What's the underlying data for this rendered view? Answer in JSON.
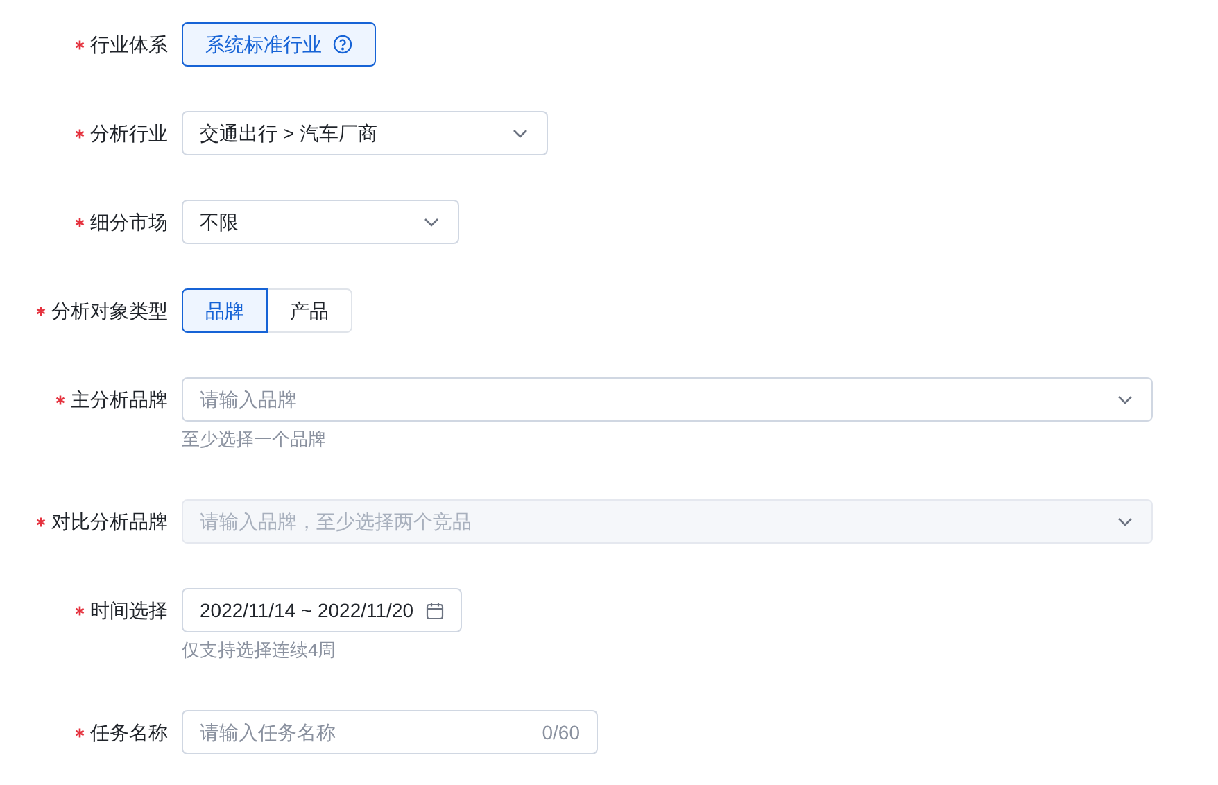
{
  "form": [
    {
      "label": "行业体系",
      "required": true,
      "kind": "tag",
      "value": "系统标准行业"
    },
    {
      "label": "分析行业",
      "required": true,
      "kind": "select",
      "value": "交通出行 > 汽车厂商"
    },
    {
      "label": "细分市场",
      "required": true,
      "kind": "select",
      "value": "不限"
    },
    {
      "label": "分析对象类型",
      "required": true,
      "kind": "segmented",
      "options": [
        {
          "label": "品牌",
          "selected": true
        },
        {
          "label": "产品",
          "selected": false
        }
      ]
    },
    {
      "label": "主分析品牌",
      "required": true,
      "kind": "select",
      "placeholder": "请输入品牌",
      "disabled": false,
      "help": "至少选择一个品牌"
    },
    {
      "label": "对比分析品牌",
      "required": true,
      "kind": "select",
      "placeholder": "请输入品牌，至少选择两个竞品",
      "disabled": true
    },
    {
      "label": "时间选择",
      "required": true,
      "kind": "date",
      "value": "2022/11/14 ~ 2022/11/20",
      "help": "仅支持选择连续4周"
    },
    {
      "label": "任务名称",
      "required": true,
      "kind": "text",
      "placeholder": "请输入任务名称",
      "counter": "0/60"
    }
  ]
}
